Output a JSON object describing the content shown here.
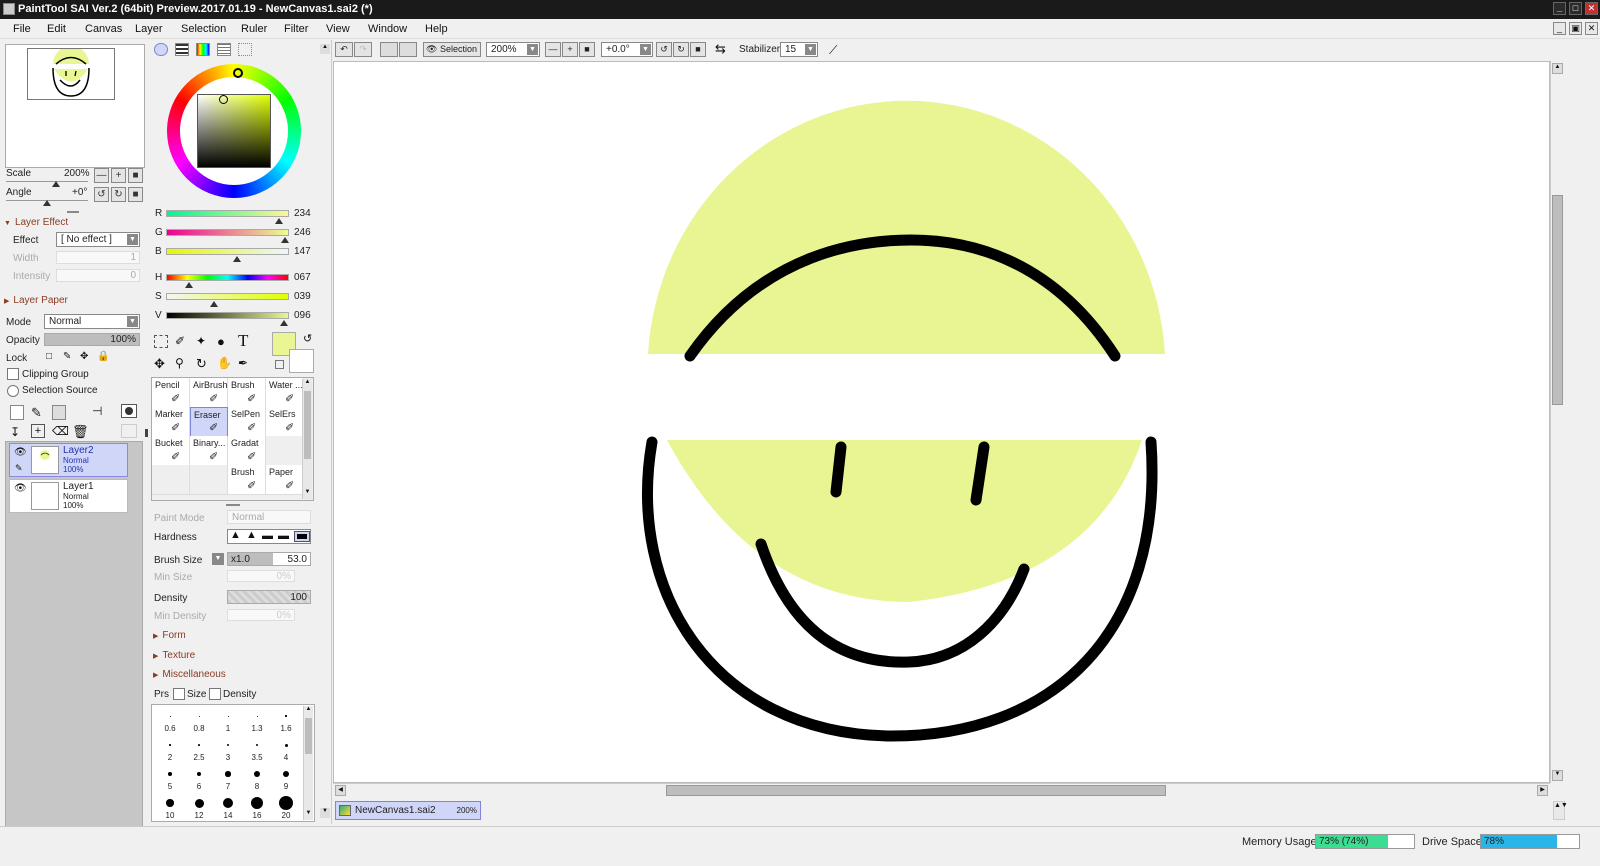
{
  "window": {
    "title": "PaintTool SAI Ver.2 (64bit) Preview.2017.01.19 - NewCanvas1.sai2 (*)",
    "controls": [
      "_",
      "□",
      "✕"
    ]
  },
  "menu": [
    "File",
    "Edit",
    "Canvas",
    "Layer",
    "Selection",
    "Ruler",
    "Filter",
    "View",
    "Window",
    "Help"
  ],
  "navigator": {
    "scale_label": "Scale",
    "scale_value": "200%",
    "angle_label": "Angle",
    "angle_value": "+0°"
  },
  "layer_effect": {
    "section": "Layer Effect",
    "effect_label": "Effect",
    "effect_value": "[ No effect ]",
    "width_label": "Width",
    "width_value": "1",
    "intensity_label": "Intensity",
    "intensity_value": "0"
  },
  "layer_paper": {
    "section": "Layer Paper",
    "mode_label": "Mode",
    "mode_value": "Normal",
    "opacity_label": "Opacity",
    "opacity_value": "100%",
    "opacity_fraction": 1.0,
    "lock_label": "Lock",
    "clipping_label": "Clipping Group",
    "selection_source_label": "Selection Source"
  },
  "layers": [
    {
      "name": "Layer2",
      "mode": "Normal",
      "opacity": "100%",
      "selected": true
    },
    {
      "name": "Layer1",
      "mode": "Normal",
      "opacity": "100%",
      "selected": false
    }
  ],
  "color": {
    "current": "#eaf693",
    "r_label": "R",
    "r": "234",
    "g_label": "G",
    "g": "246",
    "b_label": "B",
    "b": "147",
    "h_label": "H",
    "h": "067",
    "s_label": "S",
    "s": "039",
    "v_label": "V",
    "v": "096"
  },
  "tools": [
    {
      "name": "Pencil",
      "icon": "pencil-icon"
    },
    {
      "name": "AirBrush",
      "icon": "airbrush-icon"
    },
    {
      "name": "Brush",
      "icon": "brush-icon"
    },
    {
      "name": "Water ...",
      "icon": "water-icon"
    },
    {
      "name": "Marker",
      "icon": "marker-icon"
    },
    {
      "name": "Eraser",
      "icon": "eraser-icon",
      "selected": true
    },
    {
      "name": "SelPen",
      "icon": "selpen-icon"
    },
    {
      "name": "SelErs",
      "icon": "selers-icon"
    },
    {
      "name": "Bucket",
      "icon": "bucket-icon"
    },
    {
      "name": "Binary...",
      "icon": "binary-icon"
    },
    {
      "name": "Gradat",
      "icon": "gradation-icon"
    },
    {
      "name": "",
      "icon": ""
    },
    {
      "name": "",
      "icon": ""
    },
    {
      "name": "",
      "icon": ""
    },
    {
      "name": "Brush",
      "icon": "brush-icon"
    },
    {
      "name": "Paper",
      "icon": "paper-icon"
    }
  ],
  "brush": {
    "paint_mode_label": "Paint Mode",
    "paint_mode_value": "Normal",
    "hardness_label": "Hardness",
    "size_label": "Brush Size",
    "size_mult": "x1.0",
    "size_value": "53.0",
    "min_size_label": "Min Size",
    "min_size_value": "0%",
    "density_label": "Density",
    "density_value": "100",
    "min_density_label": "Min Density",
    "min_density_value": "0%",
    "form": "Form",
    "texture": "Texture",
    "misc": "Miscellaneous",
    "prs_label": "Prs",
    "prs_size": "Size",
    "prs_density": "Density"
  },
  "brush_sizes": [
    "0.6",
    "0.8",
    "1",
    "1.3",
    "1.6",
    "2",
    "2.5",
    "3",
    "3.5",
    "4",
    "5",
    "6",
    "7",
    "8",
    "9",
    "10",
    "12",
    "14",
    "16",
    "20"
  ],
  "toolbar": {
    "selection_label": "Selection",
    "zoom": "200%",
    "rotation": "+0.0°",
    "stabilizer_label": "Stabilizer",
    "stabilizer_value": "15"
  },
  "tab": {
    "name": "NewCanvas1.sai2",
    "zoom": "200%"
  },
  "status": {
    "memory_label": "Memory Usage",
    "memory_value": "73% (74%)",
    "memory_fraction": 0.73,
    "drive_label": "Drive Space",
    "drive_value": "78%",
    "drive_fraction": 0.78
  }
}
